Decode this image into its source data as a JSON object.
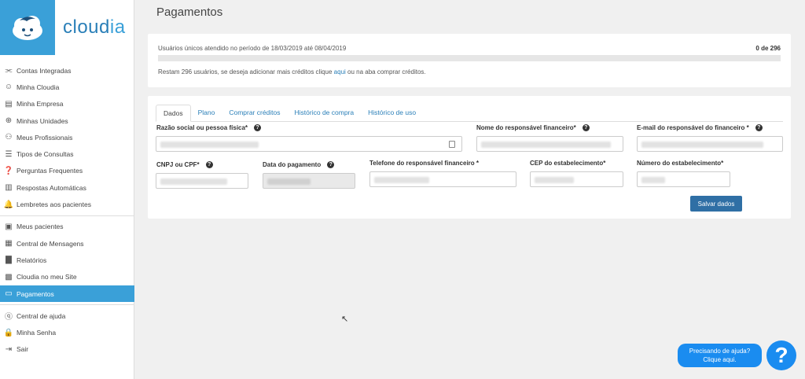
{
  "brand": {
    "name_prefix": "cloud",
    "name_suffix": "ia"
  },
  "sidebar": {
    "groups": [
      [
        {
          "label": "Contas Integradas",
          "icon": "share-icon"
        },
        {
          "label": "Minha Cloudia",
          "icon": "bot-face-icon"
        },
        {
          "label": "Minha Empresa",
          "icon": "store-icon"
        },
        {
          "label": "Minhas Unidades",
          "icon": "plus-circle-icon"
        },
        {
          "label": "Meus Profissionais",
          "icon": "people-icon"
        },
        {
          "label": "Tipos de Consultas",
          "icon": "list-icon"
        },
        {
          "label": "Perguntas Frequentes",
          "icon": "question-box-icon"
        },
        {
          "label": "Respostas Automáticas",
          "icon": "message-icon"
        },
        {
          "label": "Lembretes aos pacientes",
          "icon": "bell-icon"
        }
      ],
      [
        {
          "label": "Meus pacientes",
          "icon": "contact-card-icon"
        },
        {
          "label": "Central de Mensagens",
          "icon": "chat-icon"
        },
        {
          "label": "Relatórios",
          "icon": "chart-icon"
        },
        {
          "label": "Cloudia no meu Site",
          "icon": "widgets-icon"
        },
        {
          "label": "Pagamentos",
          "icon": "credit-card-icon",
          "active": true
        }
      ],
      [
        {
          "label": "Central de ajuda",
          "icon": "help-circle-icon"
        },
        {
          "label": "Minha Senha",
          "icon": "lock-icon"
        },
        {
          "label": "Sair",
          "icon": "logout-icon"
        }
      ]
    ]
  },
  "page": {
    "title": "Pagamentos"
  },
  "credits": {
    "period_text": "Usuários únicos atendido no período de 18/03/2019 até 08/04/2019",
    "count_text": "0 de 296",
    "progress_fraction": 0,
    "remain_prefix": "Restam 296 usuários, se deseja adicionar mais créditos clique ",
    "remain_link": "aqui",
    "remain_suffix": " ou na aba comprar créditos."
  },
  "tabs": [
    "Dados",
    "Plano",
    "Comprar créditos",
    "Histórico de compra",
    "Histórico de uso"
  ],
  "form": {
    "razao_label": "Razão social ou pessoa física*",
    "responsavel_label": "Nome do responsável financeiro*",
    "email_label": "E-mail do responsável do financeiro *",
    "cnpj_label": "CNPJ ou CPF*",
    "data_label": "Data do pagamento",
    "telefone_label": "Telefone do responsável financeiro *",
    "cep_label": "CEP do estabelecimento*",
    "numero_label": "Número do estabelecimento*",
    "save_label": "Salvar dados"
  },
  "help": {
    "line1": "Precisando de ajuda?",
    "line2": "Clique aqui.",
    "icon_glyph": "?"
  }
}
